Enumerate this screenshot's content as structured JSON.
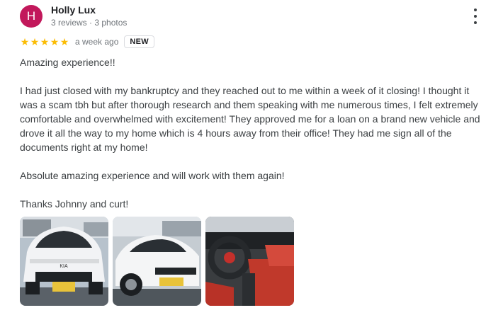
{
  "reviewer": {
    "initial": "H",
    "name": "Holly Lux",
    "stats": "3 reviews · 3 photos"
  },
  "rating": {
    "stars": 5,
    "max": 5,
    "time_ago": "a week ago",
    "badge": "NEW"
  },
  "review": {
    "paragraphs": [
      "Amazing experience!!",
      "I had just closed with my bankruptcy and they reached out to me within a week of it closing! I thought it was a scam tbh but after thorough research and them speaking with me numerous times, I felt extremely comfortable and overwhelmed with excitement! They approved me for a loan on a brand new vehicle and drove it all the way to my home which is 4 hours away from their office! They had me sign all of the documents right at my home!",
      "Absolute amazing experience and will work with them again!",
      "Thanks Johnny and curt!"
    ]
  },
  "colors": {
    "avatar": "#c2185b",
    "star": "#fbbc04"
  },
  "icons": {
    "menu": "more-vert-icon",
    "star": "star-icon"
  }
}
